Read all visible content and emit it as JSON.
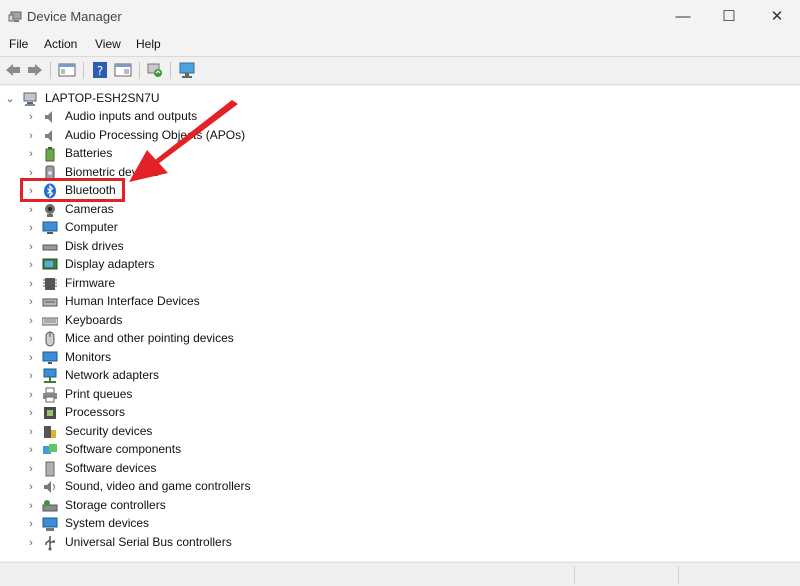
{
  "window": {
    "title": "Device Manager",
    "controls": {
      "minimize": "—",
      "maximize": "☐",
      "close": "✕"
    }
  },
  "menubar": {
    "items": [
      "File",
      "Action",
      "View",
      "Help"
    ]
  },
  "toolbar": {
    "buttons": [
      "back-icon",
      "forward-icon",
      "show-hide-console-tree-icon",
      "help-icon",
      "properties-icon",
      "update-driver-icon",
      "scan-hardware-icon"
    ]
  },
  "tree": {
    "root": {
      "label": "LAPTOP-ESH2SN7U",
      "expanded": true
    },
    "items": [
      {
        "label": "Audio inputs and outputs",
        "icon": "speaker-icon"
      },
      {
        "label": "Audio Processing Objects (APOs)",
        "icon": "speaker-icon"
      },
      {
        "label": "Batteries",
        "icon": "battery-icon"
      },
      {
        "label": "Biometric devices",
        "icon": "biometric-icon"
      },
      {
        "label": "Bluetooth",
        "icon": "bluetooth-icon"
      },
      {
        "label": "Cameras",
        "icon": "camera-icon"
      },
      {
        "label": "Computer",
        "icon": "computer-icon"
      },
      {
        "label": "Disk drives",
        "icon": "disk-drive-icon"
      },
      {
        "label": "Display adapters",
        "icon": "display-adapter-icon"
      },
      {
        "label": "Firmware",
        "icon": "firmware-icon"
      },
      {
        "label": "Human Interface Devices",
        "icon": "hid-icon"
      },
      {
        "label": "Keyboards",
        "icon": "keyboard-icon"
      },
      {
        "label": "Mice and other pointing devices",
        "icon": "mouse-icon"
      },
      {
        "label": "Monitors",
        "icon": "monitor-icon"
      },
      {
        "label": "Network adapters",
        "icon": "network-adapter-icon"
      },
      {
        "label": "Print queues",
        "icon": "printer-icon"
      },
      {
        "label": "Processors",
        "icon": "processor-icon"
      },
      {
        "label": "Security devices",
        "icon": "security-device-icon"
      },
      {
        "label": "Software components",
        "icon": "software-component-icon"
      },
      {
        "label": "Software devices",
        "icon": "software-device-icon"
      },
      {
        "label": "Sound, video and game controllers",
        "icon": "sound-controller-icon"
      },
      {
        "label": "Storage controllers",
        "icon": "storage-controller-icon"
      },
      {
        "label": "System devices",
        "icon": "system-device-icon"
      },
      {
        "label": "Universal Serial Bus controllers",
        "icon": "usb-icon"
      }
    ]
  },
  "annotation": {
    "highlighted_item": "Bluetooth",
    "color": "#e22226"
  }
}
